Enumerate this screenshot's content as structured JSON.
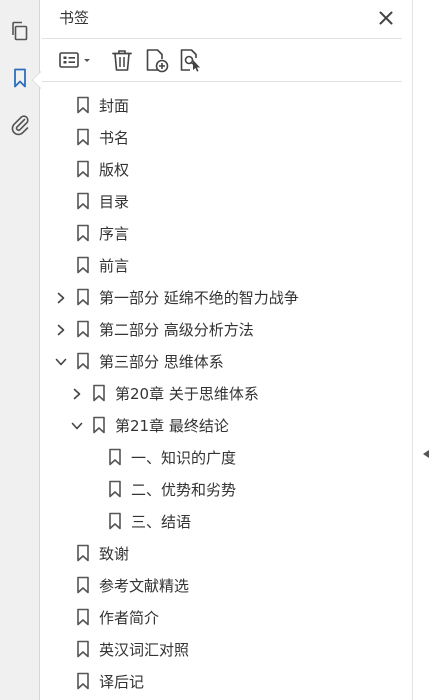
{
  "rail": {
    "items": [
      {
        "icon": "pages-icon"
      },
      {
        "icon": "bookmark-icon",
        "active": true
      },
      {
        "icon": "paperclip-icon"
      }
    ],
    "active_color": "#2c6fbe"
  },
  "panel": {
    "title": "书签"
  },
  "toolbar": {
    "items": [
      {
        "icon": "options-menu-icon"
      },
      {
        "icon": "trash-icon"
      },
      {
        "icon": "new-bookmark-icon"
      },
      {
        "icon": "bookmark-from-selection-icon"
      }
    ]
  },
  "bookmarks": [
    {
      "label": "封面",
      "level": 0,
      "expand": "none"
    },
    {
      "label": "书名",
      "level": 0,
      "expand": "none"
    },
    {
      "label": "版权",
      "level": 0,
      "expand": "none"
    },
    {
      "label": "目录",
      "level": 0,
      "expand": "none"
    },
    {
      "label": "序言",
      "level": 0,
      "expand": "none"
    },
    {
      "label": "前言",
      "level": 0,
      "expand": "none"
    },
    {
      "label": "第一部分  延绵不绝的智力战争",
      "level": 0,
      "expand": "collapsed"
    },
    {
      "label": "第二部分  高级分析方法",
      "level": 0,
      "expand": "collapsed"
    },
    {
      "label": "第三部分  思维体系",
      "level": 0,
      "expand": "expanded"
    },
    {
      "label": "第20章  关于思维体系",
      "level": 1,
      "expand": "collapsed"
    },
    {
      "label": "第21章  最终结论",
      "level": 1,
      "expand": "expanded"
    },
    {
      "label": "一、知识的广度",
      "level": 2,
      "expand": "none"
    },
    {
      "label": "二、优势和劣势",
      "level": 2,
      "expand": "none"
    },
    {
      "label": "三、结语",
      "level": 2,
      "expand": "none"
    },
    {
      "label": "致谢",
      "level": 0,
      "expand": "none"
    },
    {
      "label": "参考文献精选",
      "level": 0,
      "expand": "none"
    },
    {
      "label": "作者简介",
      "level": 0,
      "expand": "none"
    },
    {
      "label": "英汉词汇对照",
      "level": 0,
      "expand": "none"
    },
    {
      "label": "译后记",
      "level": 0,
      "expand": "none"
    }
  ]
}
